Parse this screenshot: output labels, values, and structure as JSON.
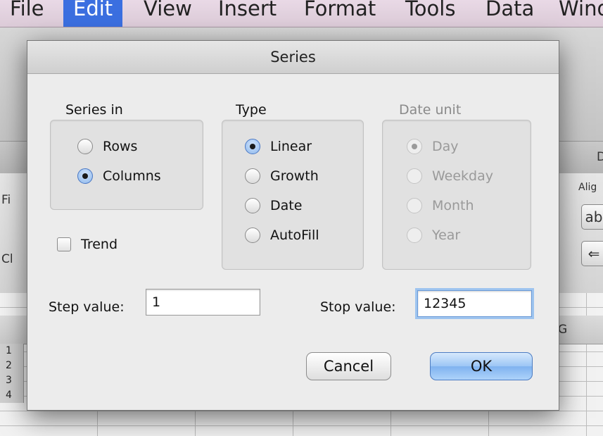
{
  "menubar": {
    "items": [
      "File",
      "Edit",
      "View",
      "Insert",
      "Format",
      "Tools",
      "Data",
      "Wind"
    ],
    "active_index": 1
  },
  "background": {
    "ribbon_left_1": "Fi",
    "ribbon_left_2": "Cl",
    "ribbon_right_tab": "D",
    "ribbon_right_label": "Alig",
    "ribbon_btn_1": "ab",
    "ribbon_btn_2": "⇐",
    "column_header": "G",
    "row_numbers": [
      "1",
      "2",
      "3",
      "4"
    ]
  },
  "dialog": {
    "title": "Series",
    "series_in": {
      "label": "Series in",
      "options": [
        {
          "label": "Rows",
          "checked": false
        },
        {
          "label": "Columns",
          "checked": true
        }
      ]
    },
    "type": {
      "label": "Type",
      "options": [
        {
          "label": "Linear",
          "checked": true
        },
        {
          "label": "Growth",
          "checked": false
        },
        {
          "label": "Date",
          "checked": false
        },
        {
          "label": "AutoFill",
          "checked": false
        }
      ]
    },
    "date_unit": {
      "label": "Date unit",
      "disabled": true,
      "options": [
        {
          "label": "Day",
          "checked": true
        },
        {
          "label": "Weekday",
          "checked": false
        },
        {
          "label": "Month",
          "checked": false
        },
        {
          "label": "Year",
          "checked": false
        }
      ]
    },
    "trend": {
      "label": "Trend",
      "checked": false
    },
    "step_value": {
      "label": "Step value:",
      "value": "1"
    },
    "stop_value": {
      "label": "Stop value:",
      "value": "12345"
    },
    "buttons": {
      "cancel": "Cancel",
      "ok": "OK"
    }
  },
  "colors": {
    "accent": "#3b6fe0",
    "default_button": "#9cc6f5",
    "focus_ring": "#9ec4ef"
  }
}
